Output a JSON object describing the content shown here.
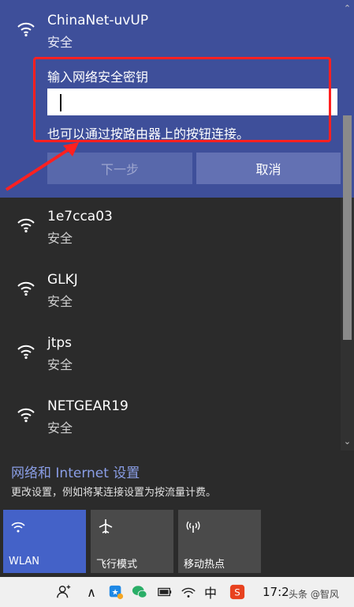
{
  "expanded_network": {
    "name": "ChinaNet-uvUP",
    "status": "安全",
    "key_label": "输入网络安全密钥",
    "key_value": "",
    "router_hint": "也可以通过按路由器上的按钮连接。",
    "next_label": "下一步",
    "cancel_label": "取消"
  },
  "networks": [
    {
      "name": "1e7cca03",
      "status": "安全"
    },
    {
      "name": "GLKJ",
      "status": "安全"
    },
    {
      "name": "jtps",
      "status": "安全"
    },
    {
      "name": "NETGEAR19",
      "status": "安全"
    }
  ],
  "settings": {
    "link": "网络和 Internet 设置",
    "desc": "更改设置，例如将某连接设置为按流量计费。"
  },
  "quick_actions": [
    {
      "label": "WLAN",
      "active": true
    },
    {
      "label": "飞行模式",
      "active": false
    },
    {
      "label": "移动热点",
      "active": false
    }
  ],
  "taskbar": {
    "ime": "中",
    "time": "17:2",
    "watermark": "头条 @智风"
  },
  "colors": {
    "expanded_bg": "#3e4f9a",
    "panel_bg": "#2b2b2b",
    "accent": "#4462c8",
    "annotation": "#ff2020"
  }
}
